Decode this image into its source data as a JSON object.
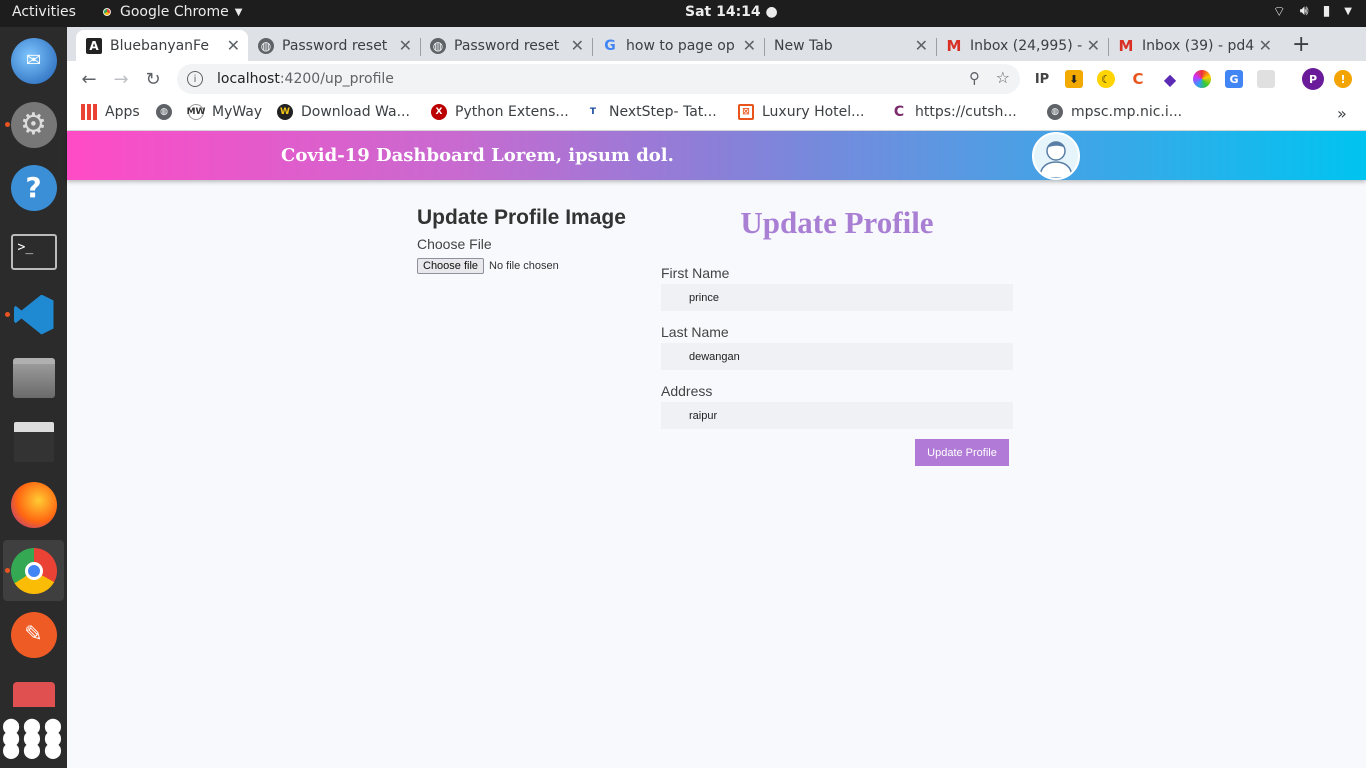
{
  "os": {
    "activities": "Activities",
    "app_menu": "Google Chrome",
    "clock": "Sat 14:14"
  },
  "browser": {
    "tabs": [
      {
        "title": "BluebanyanFe",
        "active": true
      },
      {
        "title": "Password reset"
      },
      {
        "title": "Password reset"
      },
      {
        "title": "how to page op"
      },
      {
        "title": "New Tab"
      },
      {
        "title": "Inbox (24,995) -"
      },
      {
        "title": "Inbox (39) - pd4"
      }
    ],
    "url_host": "localhost",
    "url_path": ":4200/up_profile",
    "profile_initial": "P",
    "bookmarks": [
      {
        "label": "Apps"
      },
      {
        "label": ""
      },
      {
        "label": "MyWay"
      },
      {
        "label": "Download Wa..."
      },
      {
        "label": "Python Extens..."
      },
      {
        "label": "NextStep- Tat..."
      },
      {
        "label": "Luxury Hotel..."
      },
      {
        "label": "https://cutsh..."
      },
      {
        "label": "mpsc.mp.nic.i..."
      }
    ]
  },
  "app": {
    "title": "Covid-19 Dashboard Lorem, ipsum dol.",
    "image_section": {
      "heading": "Update Profile Image",
      "choose_label": "Choose File",
      "file_button": "Choose file",
      "file_status": "No file chosen"
    },
    "form": {
      "title": "Update Profile",
      "first_name_label": "First Name",
      "first_name_value": "prince",
      "last_name_label": "Last Name",
      "last_name_value": "dewangan",
      "address_label": "Address",
      "address_value": "raipur",
      "submit_label": "Update Profile"
    }
  },
  "colors": {
    "header_gradient_start": "#ff4bc6",
    "header_gradient_end": "#00c4f0",
    "accent_purple": "#a97fd4",
    "button_purple": "#b07ad6"
  }
}
